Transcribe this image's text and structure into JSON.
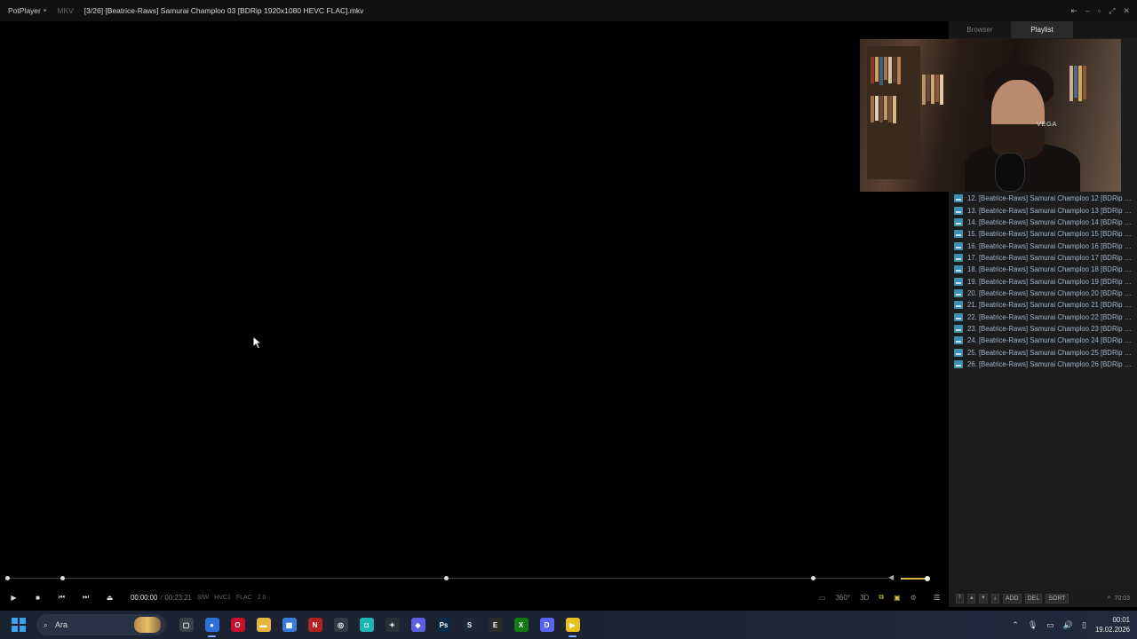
{
  "titlebar": {
    "app_name": "PotPlayer",
    "format": "MKV",
    "file_title": "[3/26] [Beatrice-Raws] Samurai Champloo 03 [BDRip 1920x1080 HEVC FLAC].mkv"
  },
  "panel": {
    "tabs": [
      {
        "label": "Browser",
        "active": false
      },
      {
        "label": "Playlist",
        "active": true
      }
    ],
    "webcam_text": "VEGA",
    "playlist": [
      "12. [Beatrice-Raws] Samurai Champloo 12 [BDRip 1...",
      "13. [Beatrice-Raws] Samurai Champloo 13 [BDRip 1...",
      "14. [Beatrice-Raws] Samurai Champloo 14 [BDRip 1...",
      "15. [Beatrice-Raws] Samurai Champloo 15 [BDRip 1...",
      "16. [Beatrice-Raws] Samurai Champloo 16 [BDRip 1...",
      "17. [Beatrice-Raws] Samurai Champloo 17 [BDRip 1...",
      "18. [Beatrice-Raws] Samurai Champloo 18 [BDRip 1...",
      "19. [Beatrice-Raws] Samurai Champloo 19 [BDRip 1...",
      "20. [Beatrice-Raws] Samurai Champloo 20 [BDRip 1...",
      "21. [Beatrice-Raws] Samurai Champloo 21 [BDRip 1...",
      "22. [Beatrice-Raws] Samurai Champloo 22 [BDRip 1...",
      "23. [Beatrice-Raws] Samurai Champloo 23 [BDRip 1...",
      "24. [Beatrice-Raws] Samurai Champloo 24 [BDRip 1...",
      "25. [Beatrice-Raws] Samurai Champloo 25 [BDRip 1...",
      "26. [Beatrice-Raws] Samurai Champloo 26 [BDRip 1..."
    ],
    "footer": {
      "add_label": "ADD",
      "del_label": "DEL",
      "sort_label": "SORT",
      "total_time": "70:03"
    }
  },
  "controls": {
    "current_time": "00:00:00",
    "separator": "/",
    "duration": "00:23:21",
    "badges": [
      "S/W",
      "HVC1",
      "FLAC",
      "2.0"
    ],
    "volume_fraction": 0.75,
    "three_d_label": "3D",
    "degree_label": "360°"
  },
  "taskbar": {
    "search_placeholder": "Ara",
    "clock_time": "00:01",
    "clock_date": "19.02.2026",
    "apps": [
      {
        "name": "file-explorer-icon",
        "glyph": "▢",
        "color": "#3a3f4a",
        "active": false
      },
      {
        "name": "chrome-icon",
        "glyph": "●",
        "color": "#2f6fd6",
        "active": true
      },
      {
        "name": "opera-icon",
        "glyph": "O",
        "color": "#c8102e",
        "active": false
      },
      {
        "name": "folder-icon",
        "glyph": "▬",
        "color": "#e7b43c",
        "active": false
      },
      {
        "name": "store-icon",
        "glyph": "▦",
        "color": "#3b7bd8",
        "active": false
      },
      {
        "name": "news-icon",
        "glyph": "N",
        "color": "#b32222",
        "active": false
      },
      {
        "name": "obs-icon",
        "glyph": "◎",
        "color": "#333a47",
        "active": false
      },
      {
        "name": "app-teal-icon",
        "glyph": "◘",
        "color": "#1db6b0",
        "active": false
      },
      {
        "name": "davinci-icon",
        "glyph": "✦",
        "color": "#2a2f3a",
        "active": false
      },
      {
        "name": "paint-icon",
        "glyph": "◆",
        "color": "#5b5fe0",
        "active": false
      },
      {
        "name": "photoshop-icon",
        "glyph": "Ps",
        "color": "#0b2a46",
        "active": false
      },
      {
        "name": "steam-icon",
        "glyph": "S",
        "color": "#1b2838",
        "active": false
      },
      {
        "name": "epic-icon",
        "glyph": "E",
        "color": "#2b2b2b",
        "active": false
      },
      {
        "name": "xbox-icon",
        "glyph": "X",
        "color": "#107c10",
        "active": false
      },
      {
        "name": "discord-icon",
        "glyph": "D",
        "color": "#5865f2",
        "active": false
      },
      {
        "name": "potplayer-icon",
        "glyph": "▶",
        "color": "#e6c11c",
        "active": true
      }
    ]
  }
}
